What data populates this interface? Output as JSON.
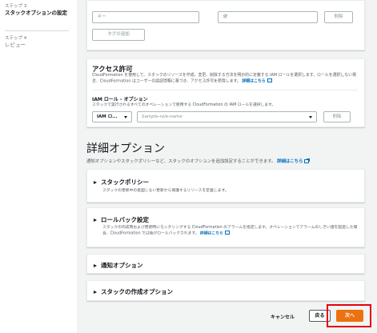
{
  "steps": {
    "current": {
      "number": "ステップ 3",
      "title": "スタックオプションの設定"
    },
    "next": {
      "number": "ステップ 4",
      "title": "レビュー"
    }
  },
  "tags": {
    "key_placeholder": "キー",
    "value_placeholder": "値",
    "remove_label": "削除",
    "add_label": "タグの追加"
  },
  "access": {
    "title": "アクセス許可",
    "description": "CloudFormation を使用して、スタックのリソースを作成、変更、削除する方法を明示的に定義する IAM ロールを選択します。ロールを選択しない場合、CloudFormation はユーザーの認証情報に基づき、アクセス許可を使用します。",
    "learn_more": "詳細はこちら",
    "role_label": "IAM ロール - オプション",
    "role_description": "スタックで実行されるすべてのオペレーションで使用する CloudFormation の IAM ロールを選択します。",
    "role_type_value": "IAM ロ...",
    "role_placeholder": "Sample-role-name",
    "remove_label": "削除"
  },
  "advanced": {
    "title": "詳細オプション",
    "description": "通知オプションやスタックポリシーなど、スタックのオプションを追加設定することができます。",
    "learn_more": "詳細はこちら",
    "sections": {
      "policy": {
        "title": "スタックポリシー",
        "description": "スタックの更新中の意図しない更新から保護するリソースを定義します。"
      },
      "rollback": {
        "title": "ロールバック設定",
        "description": "スタックの作成時および更新時にモニタリングする CloudFormation のアラームを指定します。オペレーションでアラームのしきい値を超過した場合、CloudFormation では後がロールバックされます。",
        "learn_more": "詳細はこちら"
      },
      "notify": {
        "title": "通知オプション"
      },
      "create": {
        "title": "スタックの作成オプション"
      }
    }
  },
  "footer": {
    "cancel_label": "キャンセル",
    "back_label": "戻る",
    "next_label": "次へ"
  },
  "colors": {
    "primary_button": "#ec7211",
    "highlight": "#e3000b",
    "link": "#0073bb"
  }
}
